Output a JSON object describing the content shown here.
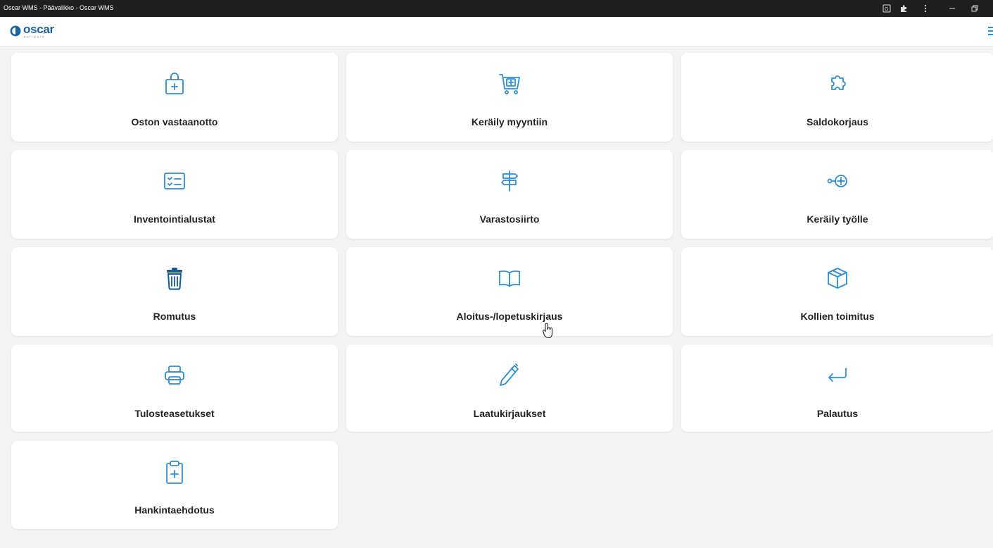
{
  "window": {
    "title": "Oscar WMS - Päävalikko - Oscar WMS",
    "controls": [
      "translate-icon",
      "extensions-icon",
      "more-vert-icon",
      "minimize-icon",
      "restore-icon"
    ]
  },
  "header": {
    "logo_text": "oscar",
    "logo_sub": "software",
    "menu_icon": "hamburger-menu-icon"
  },
  "colors": {
    "accent": "#2a8fd6",
    "brand": "#1b63a0",
    "background": "#f4f4f4",
    "tile": "#ffffff"
  },
  "tiles": [
    {
      "label": "Oston vastaanotto",
      "icon": "shopping-bag-plus-icon"
    },
    {
      "label": "Keräily myyntiin",
      "icon": "cart-plus-icon"
    },
    {
      "label": "Saldokorjaus",
      "icon": "puzzle-icon"
    },
    {
      "label": "Inventointialustat",
      "icon": "checklist-icon"
    },
    {
      "label": "Varastosiirto",
      "icon": "signpost-icon"
    },
    {
      "label": "Keräily työlle",
      "icon": "add-node-icon"
    },
    {
      "label": "Romutus",
      "icon": "trash-icon"
    },
    {
      "label": "Aloitus-/lopetuskirjaus",
      "icon": "open-book-icon"
    },
    {
      "label": "Kollien toimitus",
      "icon": "box-icon"
    },
    {
      "label": "Tulosteasetukset",
      "icon": "printer-icon"
    },
    {
      "label": "Laatukirjaukset",
      "icon": "pencil-icon"
    },
    {
      "label": "Palautus",
      "icon": "return-arrow-icon"
    },
    {
      "label": "Hankintaehdotus",
      "icon": "clipboard-plus-icon"
    }
  ]
}
